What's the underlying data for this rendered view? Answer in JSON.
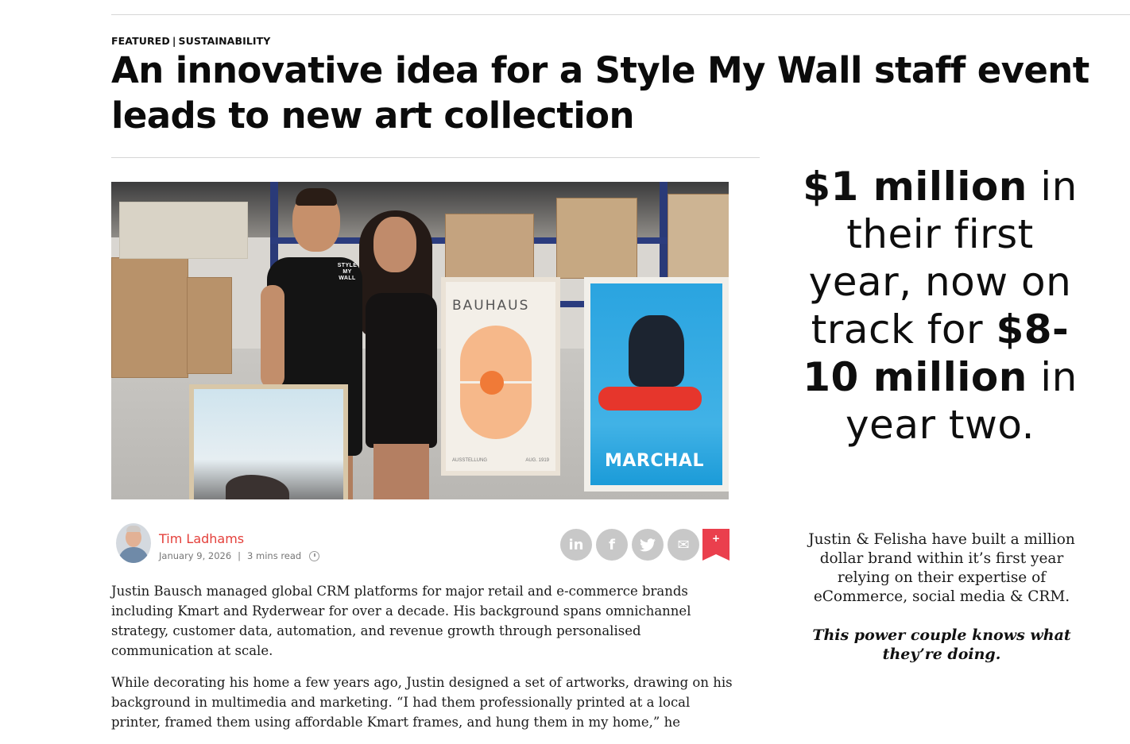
{
  "article": {
    "categories": [
      "FEATURED",
      "SUSTAINABILITY"
    ],
    "category_separator": "|",
    "headline": "An innovative idea for a Style My Wall staff event leads to new art collection",
    "image": {
      "shirt_logo": "STYLE MY WALL",
      "poster_bauhaus_title": "BAUHAUS",
      "poster_bauhaus_footer_left": "AUSSTELLUNG",
      "poster_bauhaus_footer_right": "AUG. 1919",
      "poster_marchal_title": "MARCHAL"
    },
    "author": {
      "name": "Tim Ladhams",
      "date": "January 9, 2026",
      "divider": "|",
      "read_time": "3 mins read"
    },
    "share": {
      "linkedin": "in",
      "facebook": "f",
      "twitter": "t",
      "email": "✉",
      "bookmark": "+"
    },
    "paragraphs": [
      "Justin Bausch managed global CRM platforms for major retail and e-commerce brands including Kmart and Ryderwear for over a decade. His background spans omnichannel strategy, customer data, automation, and revenue growth through personalised communication at scale.",
      "While decorating his home a few years ago, Justin designed a set of artworks, drawing on his background in multimedia and marketing. “I had them professionally printed at a local printer, framed them using affordable Kmart frames, and hung them in my home,” he"
    ]
  },
  "sidebar": {
    "promo_bold_1": "$1 million",
    "promo_text_1": " in their first year, now on track for ",
    "promo_bold_2": "$8-10 million",
    "promo_text_2": " in year two.",
    "description": "Justin & Felisha have built a million dollar brand within it’s first year relying on their expertise of eCommerce, social media & CRM.",
    "tagline": "This power couple knows what they’re doing."
  },
  "colors": {
    "accent": "#e4403b",
    "bookmark": "#ea3f4d",
    "share_button": "#c8c8c8"
  }
}
